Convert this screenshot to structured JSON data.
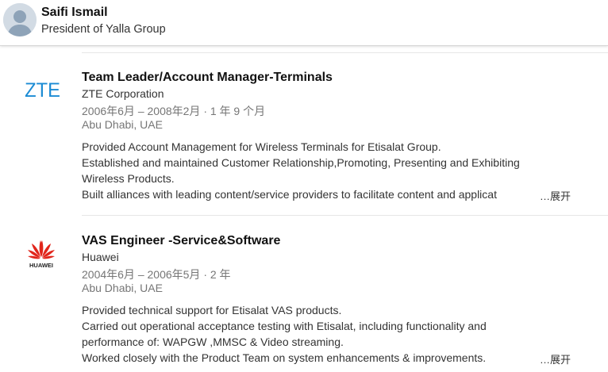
{
  "header": {
    "name": "Saifi Ismail",
    "headline": "President of Yalla Group"
  },
  "experience": [
    {
      "logo_text": "ZTE",
      "title": "Team Leader/Account Manager-Terminals",
      "company": "ZTE Corporation",
      "dates": "2006年6月 – 2008年2月 · 1 年 9 个月",
      "location": "Abu Dhabi, UAE",
      "description": [
        "Provided Account Management for Wireless Terminals for Etisalat Group.",
        "Established and maintained Customer Relationship,Promoting, Presenting and Exhibiting",
        "Wireless Products.",
        "Built alliances with leading content/service providers to facilitate content and applicat"
      ],
      "more_label": "…展开"
    },
    {
      "logo_text": "HUAWEI",
      "title": "VAS Engineer -Service&Software",
      "company": "Huawei",
      "dates": "2004年6月 – 2006年5月 · 2 年",
      "location": "Abu Dhabi, UAE",
      "description": [
        "Provided technical support for Etisalat VAS products.",
        "Carried out operational acceptance testing with Etisalat, including functionality and",
        "performance of: WAPGW ,MMSC & Video streaming.",
        "Worked closely with the Product Team on system enhancements & improvements."
      ],
      "more_label": "…展开"
    }
  ],
  "colors": {
    "zte_blue": "#1b8bd4",
    "huawei_red": "#e1251b",
    "meta_gray": "#767676"
  }
}
